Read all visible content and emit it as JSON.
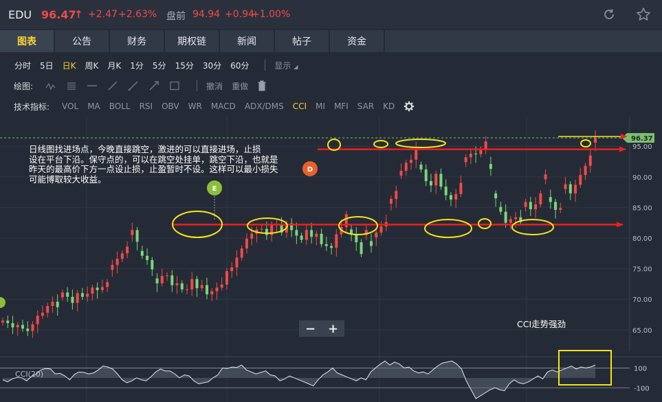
{
  "header": {
    "symbol": "EDU",
    "price": "96.47",
    "up_arrow": "↑",
    "change": "+2.47",
    "change_pct": "+2.63%",
    "premarket_label": "盘前",
    "premarket_price": "94.94",
    "premarket_change": "+0.94",
    "premarket_pct": "+1.00%",
    "up_color": "#f04a4a",
    "refresh_icon": "refresh-icon",
    "star_icon": "star-icon"
  },
  "tabs": [
    {
      "label": "图表",
      "active": true
    },
    {
      "label": "公告"
    },
    {
      "label": "财务"
    },
    {
      "label": "期权链"
    },
    {
      "label": "新闻"
    },
    {
      "label": "帖子"
    },
    {
      "label": "资金"
    }
  ],
  "periods": [
    "分时",
    "5日",
    "日K",
    "周K",
    "月K",
    "1分",
    "5分",
    "15分",
    "30分",
    "60分"
  ],
  "active_period": "日K",
  "display_label": "显示",
  "drawing": {
    "label": "绘图:",
    "tools": [
      "polyline-icon",
      "lines-icon",
      "hline-icon",
      "ray-icon",
      "segment-icon",
      "arrow-icon",
      "rectangle-icon"
    ],
    "undo": "撤消",
    "redo": "重做",
    "trash_icon": "trash-icon"
  },
  "indicators": {
    "label": "技术指标:",
    "items": [
      "VOL",
      "MA",
      "BOLL",
      "RSI",
      "OBV",
      "WR",
      "MACD",
      "ADX/DMS",
      "CCI",
      "MI",
      "MFI",
      "SAR",
      "KD"
    ],
    "active": "CCI",
    "settings_icon": "gear-icon"
  },
  "chart_data": {
    "type": "candlestick",
    "y_ticks": [
      "95.00",
      "90.00",
      "85.00",
      "80.00",
      "75.00",
      "70.00",
      "65.00"
    ],
    "ylim": [
      61.5,
      98.5
    ],
    "last_price_tag": "96.37",
    "resistance_level": 94.5,
    "support_level": 82.2,
    "marker_e": "E",
    "marker_d": "D",
    "candle_count": 120,
    "closes": [
      66.5,
      66.1,
      65.4,
      65.8,
      65.2,
      64.8,
      65.9,
      67.3,
      67.8,
      68.9,
      69.6,
      68.7,
      71.1,
      70.4,
      69.4,
      71.0,
      70.4,
      70.9,
      71.9,
      71.5,
      72.0,
      72.8,
      75.6,
      76.6,
      77.5,
      78.6,
      81.3,
      79.4,
      77.1,
      76.4,
      74.9,
      72.6,
      73.8,
      73.9,
      72.3,
      72.6,
      71.6,
      71.6,
      73.3,
      71.8,
      72.3,
      70.8,
      71.3,
      71.9,
      72.4,
      74.6,
      75.2,
      76.8,
      78.3,
      79.9,
      80.7,
      81.4,
      81.5,
      80.5,
      82.2,
      82.2,
      80.9,
      82.4,
      81.3,
      80.4,
      79.7,
      81.3,
      80.2,
      80.7,
      79.0,
      78.7,
      78.4,
      80.6,
      81.8,
      83.9,
      80.6,
      79.3,
      77.4,
      81.3,
      78.7,
      80.9,
      81.9,
      82.6,
      86.4,
      87.7,
      91.0,
      92.3,
      92.8,
      94.5,
      91.2,
      89.3,
      88.6,
      90.5,
      88.4,
      87.0,
      86.3,
      87.2,
      89.0,
      93.2,
      93.8,
      93.7,
      94.5,
      95.8,
      91.3,
      86.5,
      84.3,
      82.5,
      83.1,
      83.4,
      82.6,
      85.9,
      84.7,
      85.5,
      87.3,
      90.4,
      85.9,
      84.6,
      84.9,
      88.8,
      87.3,
      88.7,
      90.3,
      91.8,
      93.5,
      96.4
    ],
    "cci": {
      "label": "CCI(20)",
      "ticks": [
        "100",
        "-100"
      ],
      "values": [
        -20,
        -40,
        -10,
        5,
        0,
        -30,
        15,
        40,
        80,
        95,
        90,
        40,
        45,
        20,
        -20,
        35,
        60,
        55,
        40,
        50,
        80,
        120,
        110,
        90,
        40,
        -20,
        -50,
        -30,
        0,
        -20,
        -30,
        10,
        60,
        90,
        70,
        70,
        40,
        0,
        30,
        20,
        -30,
        -60,
        -50,
        -40,
        0,
        30,
        100,
        95,
        110,
        105,
        130,
        80,
        60,
        40,
        55,
        70,
        30,
        20,
        -30,
        -10,
        20,
        0,
        -20,
        -40,
        -60,
        -80,
        -20,
        30,
        60,
        100,
        50,
        30,
        10,
        -10,
        -30,
        0,
        -20,
        60,
        100,
        140,
        170,
        130,
        160,
        140,
        100,
        110,
        70,
        50,
        60,
        40,
        80,
        120,
        150,
        160,
        170,
        140,
        90,
        -30,
        -120,
        -210,
        -180,
        -150,
        -120,
        -100,
        -120,
        -130,
        -60,
        -20,
        -50,
        -60,
        -40,
        -10,
        20,
        -10,
        60,
        80,
        60,
        80,
        100,
        120,
        90,
        110,
        100,
        110,
        130
      ]
    }
  },
  "annotation_lines": [
    "日线图找进场点，今晚直接跳空，激进的可以直接进场，止损",
    "设在平台下沿。保守点的，可以在跳空处挂单，跳空下沿，也就是",
    "昨天的最高价下方一点设止损，止盈暂时不设。这样可以最小损失",
    "可能博取较大收益。"
  ],
  "cci_note": "CCI走势强劲",
  "zoom": {
    "minus": "−",
    "plus": "+"
  }
}
